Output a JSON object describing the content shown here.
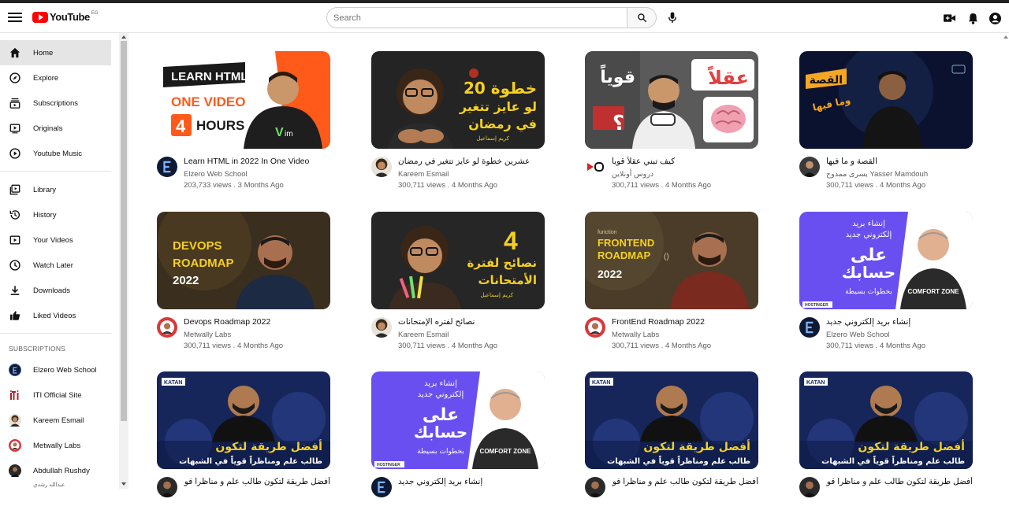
{
  "header": {
    "logo_text": "YouTube",
    "logo_country": "EG",
    "search_placeholder": "Search"
  },
  "sidebar": {
    "items": [
      {
        "label": "Home",
        "icon": "home-icon",
        "active": true
      },
      {
        "label": "Explore",
        "icon": "compass-icon"
      },
      {
        "label": "Subscriptions",
        "icon": "subscriptions-icon"
      },
      {
        "label": "Originals",
        "icon": "originals-icon"
      },
      {
        "label": "Youtube Music",
        "icon": "music-icon"
      },
      {
        "label": "Library",
        "icon": "library-icon"
      },
      {
        "label": "History",
        "icon": "history-icon"
      },
      {
        "label": "Your Videos",
        "icon": "your-videos-icon"
      },
      {
        "label": "Watch Later",
        "icon": "clock-icon"
      },
      {
        "label": "Downloads",
        "icon": "download-icon"
      },
      {
        "label": "Liked Videos",
        "icon": "thumbs-up-icon"
      }
    ],
    "subscriptions_heading": "SUBSCRIPTIONS",
    "subscriptions": [
      {
        "label": "Elzero Web School",
        "color": "#1a2a4a",
        "glyph": "E"
      },
      {
        "label": "ITI Official Site",
        "color": "#ffffff",
        "glyph": "iti"
      },
      {
        "label": "Kareem Esmail",
        "color": "#6b4a2a",
        "glyph": ""
      },
      {
        "label": "Metwally Labs",
        "color": "#d9383a",
        "glyph": ""
      },
      {
        "label": "Abdullah Rushdy",
        "color": "#2a2a2a",
        "glyph": "",
        "sub": "عبدالله رشدي"
      }
    ]
  },
  "videos": [
    {
      "title": "Learn HTML in 2022 In One Video",
      "channel": "Elzero Web School",
      "meta": "203,733 views . 3 Months Ago",
      "rtl": false,
      "thumb": "html"
    },
    {
      "title": "عشرين خطوة لو عايز تتغير في رمضان",
      "channel": "Kareem Esmail",
      "meta": "300,711 views . 4 Months Ago",
      "rtl": true,
      "thumb": "kareem20"
    },
    {
      "title": "كيف تبني عقلاً قوياً",
      "channel": "دروس أونلاين",
      "meta": "300,711 views . 4 Months Ago",
      "rtl": true,
      "thumb": "brain"
    },
    {
      "title": "القصة و ما فيها",
      "channel": "يسرى ممدوح Yasser Mamdouh",
      "meta": "300,711 views . 4 Months Ago",
      "rtl": true,
      "thumb": "story"
    },
    {
      "title": "Devops Roadmap 2022",
      "channel": "Metwally Labs",
      "meta": "300,711 views . 4 Months Ago",
      "rtl": false,
      "thumb": "devops"
    },
    {
      "title": "نصائح لفتره الإمتحانات",
      "channel": "Kareem Esmail",
      "meta": "300,711 views . 4 Months Ago",
      "rtl": true,
      "thumb": "exams"
    },
    {
      "title": "FrontEnd Roadmap 2022",
      "channel": "Metwally Labs",
      "meta": "300,711 views . 4 Months Ago",
      "rtl": false,
      "thumb": "frontend"
    },
    {
      "title": "إنشاء بريد إلكتروني جديد",
      "channel": "Elzero Web School",
      "meta": "300,711 views . 4 Months Ago",
      "rtl": true,
      "thumb": "email"
    },
    {
      "title": "أفضل طريقة لتكون طالب علم و مناظراً قوياً",
      "channel": "",
      "meta": "",
      "rtl": true,
      "thumb": "katan"
    },
    {
      "title": "إنشاء بريد إلكتروني جديد",
      "channel": "",
      "meta": "",
      "rtl": true,
      "thumb": "email"
    },
    {
      "title": "أفضل طريقة لتكون طالب علم و مناظراً قوياً",
      "channel": "",
      "meta": "",
      "rtl": true,
      "thumb": "katan"
    },
    {
      "title": "أفضل طريقة لتكون طالب علم و مناظراً قوياً",
      "channel": "",
      "meta": "",
      "rtl": true,
      "thumb": "katan"
    }
  ],
  "thumb_text": {
    "html": {
      "l1": "LEARN HTML",
      "l2": "ONE VIDEO",
      "l3": "4",
      "l4": "HOURS"
    },
    "kareem20": {
      "l1": "20 خطوة",
      "l2": "لو عايز تتغير",
      "l3": "في رمضان",
      "l4": "كريم إسماعيل"
    },
    "brain": {
      "l1": "قوياً",
      "l2": "عقلاً",
      "l3": "؟"
    },
    "story": {
      "l1": "القصة",
      "l2": "وما فيها"
    },
    "devops": {
      "l1": "DEVOPS",
      "l2": "ROADMAP",
      "l3": "2022"
    },
    "exams": {
      "l1": "4",
      "l2": "نصائح لفترة",
      "l3": "الأمتحانات",
      "l4": "كريم إسماعيل"
    },
    "frontend": {
      "l1": "function",
      "l2": "FRONTEND",
      "l3": "ROADMAP",
      "l4": "2022",
      "l5": "()"
    },
    "email": {
      "l1": "إنشاء بريد",
      "l2": "إلكتروني جديد",
      "l3": "على",
      "l4": "حسابك",
      "l5": "بخطوات بسيطة",
      "l6": "HOSTINGER",
      "l7": "COMFORT ZONE"
    },
    "katan": {
      "l1": "KATAN",
      "l2": "أفضل طريقة لتكون",
      "l3": "طالب علم ومناظراً قوياً في الشبهات"
    }
  },
  "colors": {
    "brand_red": "#ff0000",
    "active_bg": "#e5e5e5",
    "meta_text": "#606060"
  }
}
